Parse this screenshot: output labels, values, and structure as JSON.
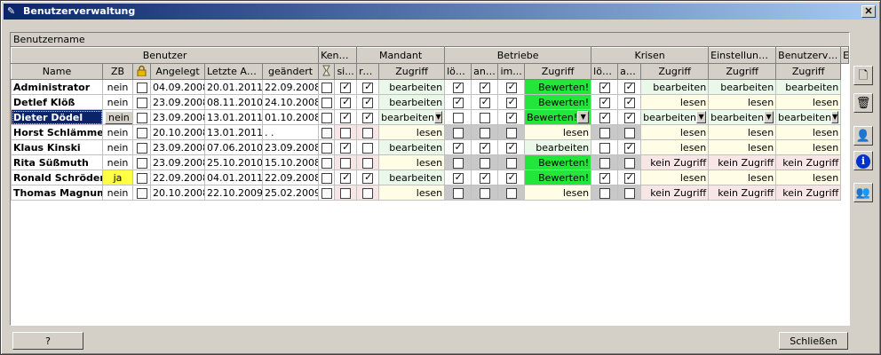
{
  "window": {
    "title": "Benutzerverwaltung",
    "close_label": "✕"
  },
  "column_header_label": "Benutzername",
  "groups": [
    {
      "label": "Benutzer",
      "span": 6
    },
    {
      "label": "Kennwort",
      "span": 2
    },
    {
      "label": "Mandant",
      "span": 2
    },
    {
      "label": "Betriebe",
      "span": 4
    },
    {
      "label": "Krisen",
      "span": 3
    },
    {
      "label": "Einstellungen",
      "span": 1
    },
    {
      "label": "Benutzerverw.",
      "span": 1
    },
    {
      "label": "Ereignisprot.",
      "span": 1
    }
  ],
  "columns": [
    "Name",
    "ZB",
    "lock-icon",
    "Angelegt",
    "Letzte An...",
    "geändert",
    "hourglass-icon",
    "si...",
    "re...",
    "Zugriff",
    "lös...",
    "anf...",
    "im...",
    "Zugriff",
    "lös...",
    "anf...",
    "Zugriff",
    "Zugriff",
    "Zugriff"
  ],
  "rows": [
    {
      "name": "Administrator",
      "zb": "nein",
      "lock": false,
      "angelegt": "04.09.2008",
      "letzte": "20.01.2011",
      "geaendert": "22.09.2008",
      "pw_flag": false,
      "si": true,
      "re": true,
      "betr_zugriff": "bearbeiten",
      "betr_loes": true,
      "betr_anf": true,
      "betr_im": true,
      "kris_zugriff": "Bewerten!",
      "kris_loes": true,
      "kris_anf": true,
      "einst": "bearbeiten",
      "bverw": "bearbeiten",
      "eprot": "bearbeiten"
    },
    {
      "name": "Detlef Klöß",
      "zb": "nein",
      "lock": false,
      "angelegt": "23.09.2008",
      "letzte": "08.11.2010",
      "geaendert": "24.10.2008",
      "pw_flag": false,
      "si": true,
      "re": true,
      "betr_zugriff": "bearbeiten",
      "betr_loes": true,
      "betr_anf": true,
      "betr_im": true,
      "kris_zugriff": "Bewerten!",
      "kris_loes": true,
      "kris_anf": true,
      "einst": "lesen",
      "bverw": "lesen",
      "eprot": "lesen"
    },
    {
      "name": "Dieter Dödel",
      "zb": "nein",
      "lock": false,
      "angelegt": "23.09.2008",
      "letzte": "13.01.2011",
      "geaendert": "01.10.2008",
      "pw_flag": false,
      "si": true,
      "re": true,
      "betr_zugriff": "bearbeiten",
      "betr_loes": false,
      "betr_anf": false,
      "betr_im": true,
      "kris_zugriff": "Bewerten!",
      "kris_loes": true,
      "kris_anf": true,
      "einst": "bearbeiten",
      "bverw": "bearbeiten",
      "eprot": "bearbeiten"
    },
    {
      "name": "Horst Schlämmer",
      "zb": "nein",
      "lock": false,
      "angelegt": "20.10.2008",
      "letzte": "13.01.2011",
      "geaendert": ". .",
      "pw_flag": false,
      "si": false,
      "re": false,
      "betr_zugriff": "lesen",
      "betr_loes": false,
      "betr_anf": false,
      "betr_im": false,
      "kris_zugriff": "lesen",
      "kris_loes": false,
      "kris_anf": false,
      "einst": "lesen",
      "bverw": "lesen",
      "eprot": "lesen"
    },
    {
      "name": "Klaus Kinski",
      "zb": "nein",
      "lock": false,
      "angelegt": "23.09.2008",
      "letzte": "07.06.2010",
      "geaendert": "23.09.2008",
      "pw_flag": false,
      "si": true,
      "re": false,
      "betr_zugriff": "bearbeiten",
      "betr_loes": true,
      "betr_anf": true,
      "betr_im": true,
      "kris_zugriff": "bearbeiten",
      "kris_loes": false,
      "kris_anf": true,
      "einst": "lesen",
      "bverw": "lesen",
      "eprot": "lesen"
    },
    {
      "name": "Rita Süßmuth",
      "zb": "nein",
      "lock": false,
      "angelegt": "23.09.2008",
      "letzte": "25.10.2010",
      "geaendert": "15.10.2008",
      "pw_flag": false,
      "si": false,
      "re": false,
      "betr_zugriff": "lesen",
      "betr_loes": false,
      "betr_anf": false,
      "betr_im": false,
      "kris_zugriff": "Bewerten!",
      "kris_loes": false,
      "kris_anf": false,
      "einst": "kein Zugriff",
      "bverw": "kein Zugriff",
      "eprot": "kein Zugriff"
    },
    {
      "name": "Ronald Schröder",
      "zb": "ja",
      "lock": false,
      "angelegt": "22.09.2008",
      "letzte": "04.01.2011",
      "geaendert": "22.09.2008",
      "pw_flag": false,
      "si": true,
      "re": true,
      "betr_zugriff": "bearbeiten",
      "betr_loes": true,
      "betr_anf": true,
      "betr_im": true,
      "kris_zugriff": "Bewerten!",
      "kris_loes": true,
      "kris_anf": true,
      "einst": "lesen",
      "bverw": "lesen",
      "eprot": "lesen"
    },
    {
      "name": "Thomas Magnum",
      "zb": "nein",
      "lock": false,
      "angelegt": "20.10.2008",
      "letzte": "22.10.2009",
      "geaendert": "25.02.2009",
      "pw_flag": false,
      "si": false,
      "re": false,
      "betr_zugriff": "lesen",
      "betr_loes": false,
      "betr_anf": false,
      "betr_im": false,
      "kris_zugriff": "lesen",
      "kris_loes": false,
      "kris_anf": false,
      "einst": "kein Zugriff",
      "bverw": "kein Zugriff",
      "eprot": "kein Zugriff"
    }
  ],
  "selected_row": 2,
  "side_buttons": [
    {
      "name": "new-document-button",
      "icon": "new-document-icon",
      "glyph": "🗋"
    },
    {
      "name": "delete-button",
      "icon": "trash-icon",
      "glyph": "🗑"
    },
    {
      "name": "user-button",
      "icon": "user-icon",
      "glyph": "👤"
    },
    {
      "name": "info-button",
      "icon": "info-icon",
      "glyph": "i"
    },
    {
      "name": "user-settings-button",
      "icon": "user-settings-icon",
      "glyph": "👥"
    }
  ],
  "buttons": {
    "help": "?",
    "close": "Schließen"
  },
  "colors": {
    "title_start": "#0a246a",
    "title_end": "#a6caf0",
    "bright_green": "#22e63a",
    "light_green": "#e9f8e9",
    "light_pink": "#f8e6e6",
    "light_yellow": "#fffde6",
    "zb_yellow": "#ffff44"
  }
}
